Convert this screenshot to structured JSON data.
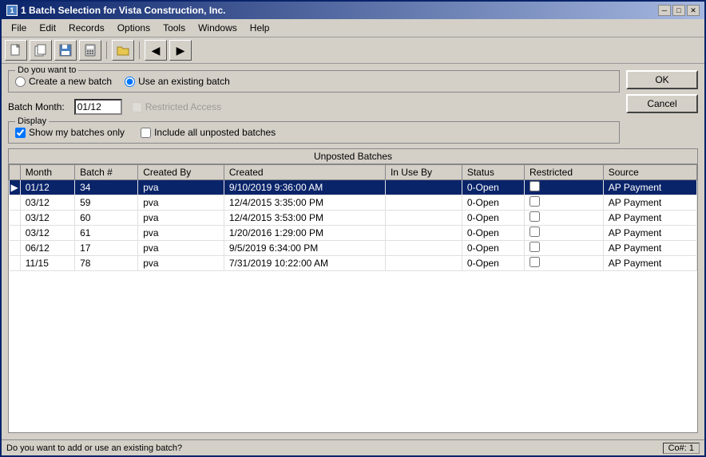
{
  "window": {
    "title": "1 Batch Selection for Vista Construction, Inc.",
    "icon": "1"
  },
  "titlebar_buttons": {
    "minimize": "─",
    "maximize": "□",
    "close": "✕"
  },
  "menu": {
    "items": [
      "File",
      "Edit",
      "Records",
      "Options",
      "Tools",
      "Windows",
      "Help"
    ]
  },
  "toolbar": {
    "buttons": [
      "📄",
      "📋",
      "💾",
      "🖩",
      "📁",
      "◀",
      "▶"
    ]
  },
  "do_you_want_to": {
    "label": "Do you want to",
    "options": [
      {
        "id": "create",
        "label": "Create a new batch",
        "checked": false
      },
      {
        "id": "existing",
        "label": "Use an existing batch",
        "checked": true
      }
    ]
  },
  "batch_month": {
    "label": "Batch Month:",
    "value": "01/12"
  },
  "restricted_access": {
    "label": "Restricted Access",
    "checked": false,
    "disabled": true
  },
  "display": {
    "label": "Display",
    "checkboxes": [
      {
        "id": "show_my",
        "label": "Show my batches only",
        "checked": true
      },
      {
        "id": "include_all",
        "label": "Include all unposted batches",
        "checked": false
      }
    ]
  },
  "buttons": {
    "ok": "OK",
    "cancel": "Cancel"
  },
  "table": {
    "title": "Unposted Batches",
    "columns": [
      "Month",
      "Batch #",
      "Created By",
      "Created",
      "In Use By",
      "Status",
      "Restricted",
      "Source"
    ],
    "rows": [
      {
        "selected": true,
        "indicator": "▶",
        "month": "01/12",
        "batch": "34",
        "created_by": "pva",
        "created": "9/10/2019 9:36:00 AM",
        "in_use_by": "",
        "status": "0-Open",
        "restricted": false,
        "source": "AP Payment"
      },
      {
        "selected": false,
        "indicator": "",
        "month": "03/12",
        "batch": "59",
        "created_by": "pva",
        "created": "12/4/2015 3:35:00 PM",
        "in_use_by": "",
        "status": "0-Open",
        "restricted": false,
        "source": "AP Payment"
      },
      {
        "selected": false,
        "indicator": "",
        "month": "03/12",
        "batch": "60",
        "created_by": "pva",
        "created": "12/4/2015 3:53:00 PM",
        "in_use_by": "",
        "status": "0-Open",
        "restricted": false,
        "source": "AP Payment"
      },
      {
        "selected": false,
        "indicator": "",
        "month": "03/12",
        "batch": "61",
        "created_by": "pva",
        "created": "1/20/2016 1:29:00 PM",
        "in_use_by": "",
        "status": "0-Open",
        "restricted": false,
        "source": "AP Payment"
      },
      {
        "selected": false,
        "indicator": "",
        "month": "06/12",
        "batch": "17",
        "created_by": "pva",
        "created": "9/5/2019 6:34:00 PM",
        "in_use_by": "",
        "status": "0-Open",
        "restricted": false,
        "source": "AP Payment"
      },
      {
        "selected": false,
        "indicator": "",
        "month": "11/15",
        "batch": "78",
        "created_by": "pva",
        "created": "7/31/2019 10:22:00 AM",
        "in_use_by": "",
        "status": "0-Open",
        "restricted": false,
        "source": "AP Payment"
      }
    ]
  },
  "status_bar": {
    "message": "Do you want to add or use an existing batch?",
    "right": "Co#: 1"
  }
}
